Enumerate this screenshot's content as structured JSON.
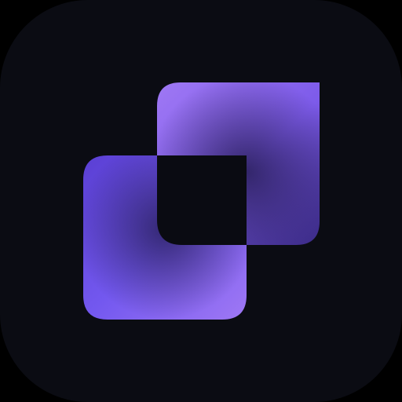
{
  "app_icon": {
    "icon": "overlapping-squares-logo-icon",
    "colors": {
      "tile_background": "#0b0c13",
      "page_background": "#000000",
      "violet_light": "#9f78f4",
      "violet_mid": "#7d5bea",
      "violet_deep": "#5a3fd3",
      "violet_shadow": "#3a2a86",
      "cutout": "#0a0b12"
    }
  }
}
